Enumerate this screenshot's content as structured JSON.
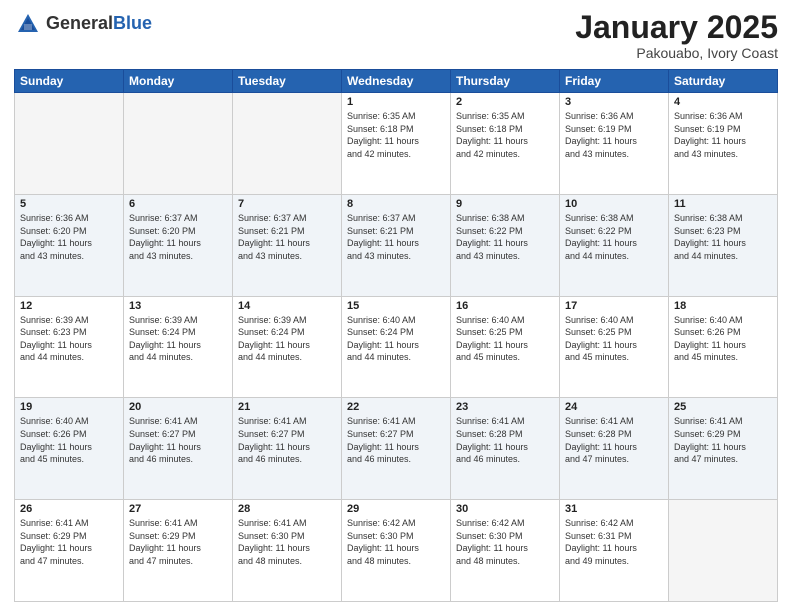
{
  "header": {
    "logo_general": "General",
    "logo_blue": "Blue",
    "title": "January 2025",
    "subtitle": "Pakouabo, Ivory Coast"
  },
  "days_of_week": [
    "Sunday",
    "Monday",
    "Tuesday",
    "Wednesday",
    "Thursday",
    "Friday",
    "Saturday"
  ],
  "weeks": [
    [
      {
        "num": "",
        "info": ""
      },
      {
        "num": "",
        "info": ""
      },
      {
        "num": "",
        "info": ""
      },
      {
        "num": "1",
        "info": "Sunrise: 6:35 AM\nSunset: 6:18 PM\nDaylight: 11 hours\nand 42 minutes."
      },
      {
        "num": "2",
        "info": "Sunrise: 6:35 AM\nSunset: 6:18 PM\nDaylight: 11 hours\nand 42 minutes."
      },
      {
        "num": "3",
        "info": "Sunrise: 6:36 AM\nSunset: 6:19 PM\nDaylight: 11 hours\nand 43 minutes."
      },
      {
        "num": "4",
        "info": "Sunrise: 6:36 AM\nSunset: 6:19 PM\nDaylight: 11 hours\nand 43 minutes."
      }
    ],
    [
      {
        "num": "5",
        "info": "Sunrise: 6:36 AM\nSunset: 6:20 PM\nDaylight: 11 hours\nand 43 minutes."
      },
      {
        "num": "6",
        "info": "Sunrise: 6:37 AM\nSunset: 6:20 PM\nDaylight: 11 hours\nand 43 minutes."
      },
      {
        "num": "7",
        "info": "Sunrise: 6:37 AM\nSunset: 6:21 PM\nDaylight: 11 hours\nand 43 minutes."
      },
      {
        "num": "8",
        "info": "Sunrise: 6:37 AM\nSunset: 6:21 PM\nDaylight: 11 hours\nand 43 minutes."
      },
      {
        "num": "9",
        "info": "Sunrise: 6:38 AM\nSunset: 6:22 PM\nDaylight: 11 hours\nand 43 minutes."
      },
      {
        "num": "10",
        "info": "Sunrise: 6:38 AM\nSunset: 6:22 PM\nDaylight: 11 hours\nand 44 minutes."
      },
      {
        "num": "11",
        "info": "Sunrise: 6:38 AM\nSunset: 6:23 PM\nDaylight: 11 hours\nand 44 minutes."
      }
    ],
    [
      {
        "num": "12",
        "info": "Sunrise: 6:39 AM\nSunset: 6:23 PM\nDaylight: 11 hours\nand 44 minutes."
      },
      {
        "num": "13",
        "info": "Sunrise: 6:39 AM\nSunset: 6:24 PM\nDaylight: 11 hours\nand 44 minutes."
      },
      {
        "num": "14",
        "info": "Sunrise: 6:39 AM\nSunset: 6:24 PM\nDaylight: 11 hours\nand 44 minutes."
      },
      {
        "num": "15",
        "info": "Sunrise: 6:40 AM\nSunset: 6:24 PM\nDaylight: 11 hours\nand 44 minutes."
      },
      {
        "num": "16",
        "info": "Sunrise: 6:40 AM\nSunset: 6:25 PM\nDaylight: 11 hours\nand 45 minutes."
      },
      {
        "num": "17",
        "info": "Sunrise: 6:40 AM\nSunset: 6:25 PM\nDaylight: 11 hours\nand 45 minutes."
      },
      {
        "num": "18",
        "info": "Sunrise: 6:40 AM\nSunset: 6:26 PM\nDaylight: 11 hours\nand 45 minutes."
      }
    ],
    [
      {
        "num": "19",
        "info": "Sunrise: 6:40 AM\nSunset: 6:26 PM\nDaylight: 11 hours\nand 45 minutes."
      },
      {
        "num": "20",
        "info": "Sunrise: 6:41 AM\nSunset: 6:27 PM\nDaylight: 11 hours\nand 46 minutes."
      },
      {
        "num": "21",
        "info": "Sunrise: 6:41 AM\nSunset: 6:27 PM\nDaylight: 11 hours\nand 46 minutes."
      },
      {
        "num": "22",
        "info": "Sunrise: 6:41 AM\nSunset: 6:27 PM\nDaylight: 11 hours\nand 46 minutes."
      },
      {
        "num": "23",
        "info": "Sunrise: 6:41 AM\nSunset: 6:28 PM\nDaylight: 11 hours\nand 46 minutes."
      },
      {
        "num": "24",
        "info": "Sunrise: 6:41 AM\nSunset: 6:28 PM\nDaylight: 11 hours\nand 47 minutes."
      },
      {
        "num": "25",
        "info": "Sunrise: 6:41 AM\nSunset: 6:29 PM\nDaylight: 11 hours\nand 47 minutes."
      }
    ],
    [
      {
        "num": "26",
        "info": "Sunrise: 6:41 AM\nSunset: 6:29 PM\nDaylight: 11 hours\nand 47 minutes."
      },
      {
        "num": "27",
        "info": "Sunrise: 6:41 AM\nSunset: 6:29 PM\nDaylight: 11 hours\nand 47 minutes."
      },
      {
        "num": "28",
        "info": "Sunrise: 6:41 AM\nSunset: 6:30 PM\nDaylight: 11 hours\nand 48 minutes."
      },
      {
        "num": "29",
        "info": "Sunrise: 6:42 AM\nSunset: 6:30 PM\nDaylight: 11 hours\nand 48 minutes."
      },
      {
        "num": "30",
        "info": "Sunrise: 6:42 AM\nSunset: 6:30 PM\nDaylight: 11 hours\nand 48 minutes."
      },
      {
        "num": "31",
        "info": "Sunrise: 6:42 AM\nSunset: 6:31 PM\nDaylight: 11 hours\nand 49 minutes."
      },
      {
        "num": "",
        "info": ""
      }
    ]
  ]
}
